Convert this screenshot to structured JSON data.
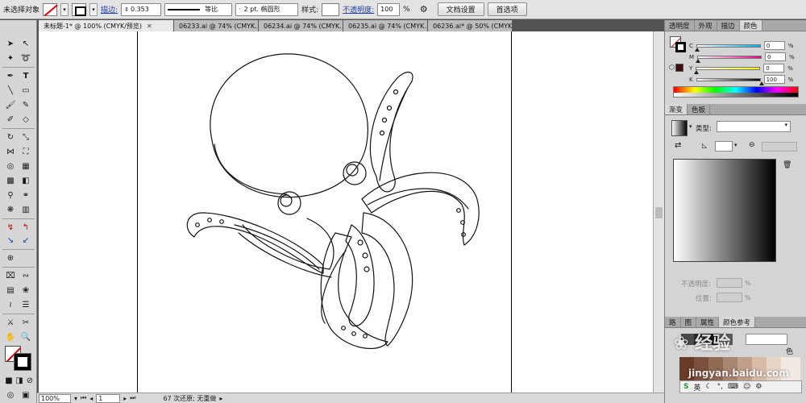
{
  "control_bar": {
    "selection_label": "未选择对象",
    "stroke_label": "描边:",
    "stroke_weight": "0.353",
    "profile_label": "等比",
    "brush_label": "2 pt. 椭圆形",
    "style_label": "样式:",
    "opacity_label": "不透明度:",
    "opacity_value": "100",
    "opacity_unit": "%",
    "doc_setup_button": "文档设置",
    "preferences_button": "首选项"
  },
  "tabs": [
    {
      "label": "未标题-1* @ 100% (CMYK/预览)",
      "active": true
    },
    {
      "label": "06233.ai @ 74% (CMYK...",
      "active": false
    },
    {
      "label": "06234.ai @ 74% (CMYK...",
      "active": false
    },
    {
      "label": "06235.ai @ 74% (CMYK...",
      "active": false
    },
    {
      "label": "06236.ai* @ 50% (CMYK...",
      "active": false
    }
  ],
  "tab_close_glyph": "✕",
  "status_bar": {
    "zoom": "100%",
    "page": "1",
    "undo_info": "67 次还原; 无重做"
  },
  "color_panel": {
    "tabs": [
      "透明度",
      "外观",
      "描边",
      "颜色"
    ],
    "channels": [
      {
        "name": "C",
        "value": "0"
      },
      {
        "name": "M",
        "value": "0"
      },
      {
        "name": "Y",
        "value": "0"
      },
      {
        "name": "K",
        "value": "100"
      }
    ]
  },
  "gradient_panel": {
    "tabs": [
      "渐变",
      "色板"
    ],
    "type_label": "类型:",
    "opacity_label": "不透明度:",
    "position_label": "位置:",
    "percent": "%"
  },
  "bottom_panel": {
    "tabs": [
      "路",
      "图",
      "属性",
      "颜色参考"
    ],
    "label_fragment": "色"
  },
  "watermark": {
    "brand": "经验",
    "url": "jingyan.baidu.com"
  },
  "colors": {
    "accent_link": "#1f3fa8",
    "panel_bg": "#d4d4d4",
    "canvas_bg": "#ffffff",
    "chrome_bg": "#535353"
  },
  "icons": [
    "selection-tool-icon",
    "direct-selection-tool-icon",
    "magic-wand-icon",
    "lasso-icon",
    "pen-tool-icon",
    "type-tool-icon",
    "line-tool-icon",
    "rectangle-tool-icon",
    "paintbrush-icon",
    "pencil-icon",
    "rotate-icon",
    "scale-icon",
    "eyedropper-icon",
    "hand-tool-icon",
    "zoom-tool-icon"
  ]
}
